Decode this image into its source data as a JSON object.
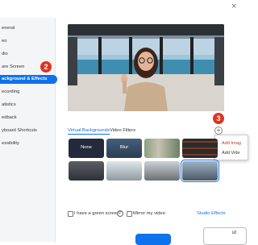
{
  "sidebar": {
    "items": [
      {
        "label": "eneral"
      },
      {
        "label": "eo"
      },
      {
        "label": "dio"
      },
      {
        "label": "are Screen"
      },
      {
        "label": "ackground & Effects",
        "active": true
      },
      {
        "label": "ecording"
      },
      {
        "label": "atistics"
      },
      {
        "label": "edback"
      },
      {
        "label": "yboard Shortcuts"
      },
      {
        "label": "essibility"
      }
    ]
  },
  "annotations": {
    "step2": "2",
    "step3": "3"
  },
  "tabs": {
    "virtual": "Virtual Backgrounds",
    "filters": "Video Filters"
  },
  "add_button": {
    "symbol": "+"
  },
  "add_menu": {
    "add_image": "Add Imag",
    "add_video": "Add Vide"
  },
  "backgrounds": {
    "none": "None",
    "blur": "Blur"
  },
  "footer": {
    "green_screen": "I have a green screen",
    "help": "?",
    "mirror": "Mirror my video",
    "studio_effects": "Studio Effects"
  },
  "bottom_button_partial": "ut",
  "titlebar": {
    "close": "×"
  },
  "colors": {
    "accent": "#0e72ed",
    "annotation_red": "#e0341d",
    "menu_red": "#c0392b"
  }
}
